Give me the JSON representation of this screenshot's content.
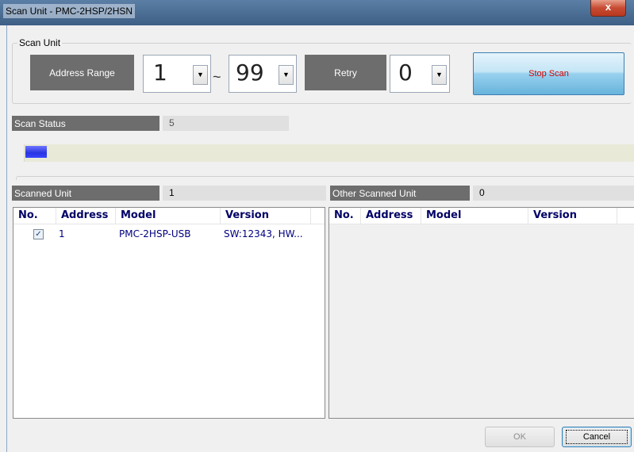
{
  "window": {
    "title": "Scan Unit  - PMC-2HSP/2HSN",
    "close_label": "x"
  },
  "scan_unit": {
    "group_label": "Scan Unit",
    "address_range_label": "Address Range",
    "range_from": "1",
    "range_separator": "~",
    "range_to": "99",
    "retry_label": "Retry",
    "retry_value": "0",
    "stop_scan_label": "Stop Scan"
  },
  "status": {
    "label": "Scan Status",
    "value": "5",
    "progress_fraction": 0.035
  },
  "scanned": {
    "label": "Scanned Unit",
    "count": "1",
    "columns": {
      "no": "No.",
      "address": "Address",
      "model": "Model",
      "version": "Version"
    },
    "rows": [
      {
        "checked": true,
        "address": "1",
        "model": "PMC-2HSP-USB",
        "version": "SW:12343, HW..."
      }
    ]
  },
  "other": {
    "label": "Other Scanned Unit",
    "count": "0",
    "columns": {
      "no": "No.",
      "address": "Address",
      "model": "Model",
      "version": "Version"
    }
  },
  "buttons": {
    "ok": "OK",
    "cancel": "Cancel"
  },
  "icons": {
    "close": "close-icon",
    "dropdown": "chevron-down-icon",
    "check": "checkmark-icon"
  },
  "colors": {
    "stop_text": "#d40000",
    "progress": "#2a34e0",
    "list_text": "#000080"
  }
}
